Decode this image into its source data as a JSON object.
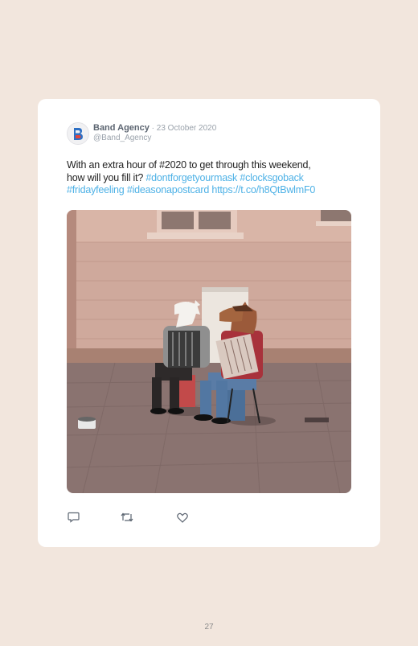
{
  "tweet": {
    "author_name": "Band Agency",
    "separator": " · ",
    "date": "23 October 2020",
    "handle": "@Band_Agency",
    "text_line1": "With an extra hour of #2020 to get through this weekend,",
    "text_line2_plain": "how will you fill it? ",
    "hashtag_mask": "#dontforgetyourmask",
    "hashtag_clocks": " #clocksgoback",
    "hashtag_friday": "#fridayfeeling",
    "hashtag_postcard": " #ideasonapostcard",
    "link": " https://t.co/h8QtBwlmF0"
  },
  "actions": {
    "reply_icon": "reply-icon",
    "retweet_icon": "retweet-icon",
    "like_icon": "heart-icon"
  },
  "colors": {
    "background": "#f2e6dd",
    "link": "#4db1e6",
    "name": "#5b6470"
  },
  "page_number": "27"
}
